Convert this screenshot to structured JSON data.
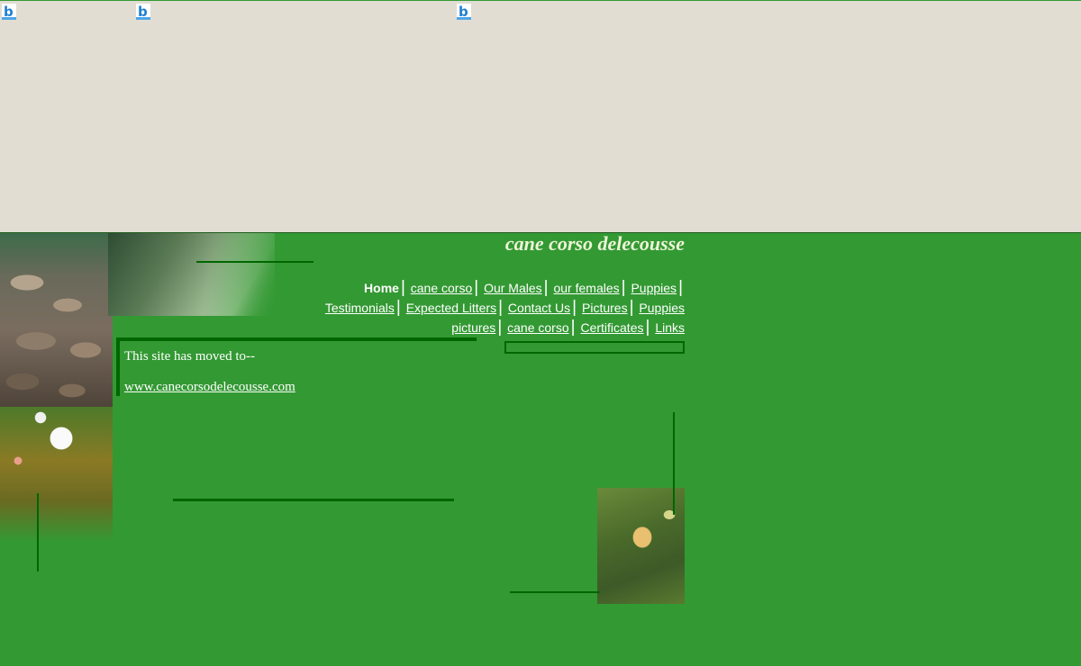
{
  "site": {
    "title": "cane corso delecousse"
  },
  "nav": {
    "items": [
      {
        "label": "Home",
        "current": true
      },
      {
        "label": "cane corso"
      },
      {
        "label": "Our Males"
      },
      {
        "label": "our females"
      },
      {
        "label": "Puppies"
      },
      {
        "label": "Testimonials"
      },
      {
        "label": "Expected Litters"
      },
      {
        "label": "Contact Us"
      },
      {
        "label": "Pictures"
      },
      {
        "label": "Puppies"
      },
      {
        "label": "pictures"
      },
      {
        "label": "cane corso"
      },
      {
        "label": "Certificates"
      },
      {
        "label": "Links"
      }
    ]
  },
  "content": {
    "message": "This site has moved to--",
    "new_url": "www.canecorsodelecousse.com"
  },
  "icons": {
    "banner_icon": "b-logo-icon"
  },
  "colors": {
    "page_background": "#339933",
    "banner_background": "#e1ddd3",
    "accent_line": "#006600",
    "title_color": "#eef5d8"
  }
}
